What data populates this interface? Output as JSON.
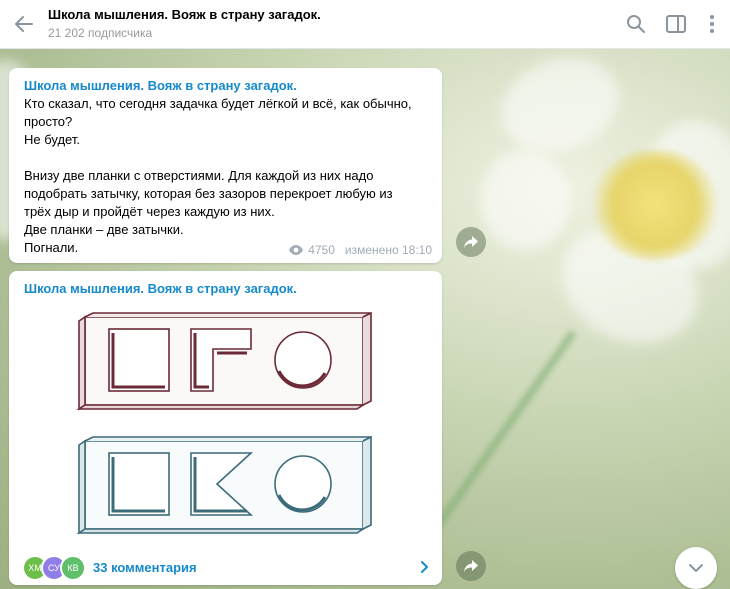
{
  "header": {
    "title": "Школа мышления. Вояж в страну загадок.",
    "subtitle": "21 202 подписчика"
  },
  "messages": [
    {
      "channel": "Школа мышления. Вояж в страну загадок.",
      "text": "Кто сказал, что сегодня задачка будет лёгкой и всё, как обычно,\nпросто?\nНе будет.\n\nВнизу две планки с отверстиями. Для каждой из них надо\nподобрать затычку, которая без зазоров перекроет любую из\nтрёх дыр и пройдёт через каждую из них.\nДве планки – две затычки.\nПогнали.",
      "views": "4750",
      "edited": "изменено 18:10"
    },
    {
      "channel": "Школа мышления. Вояж в страну загадок.",
      "comments": "33 комментария",
      "avatars": [
        {
          "initials": "ХМ",
          "color": "#6cc04a"
        },
        {
          "initials": "СУ",
          "color": "#8f7ee6"
        },
        {
          "initials": "КВ",
          "color": "#5fbf6a"
        }
      ]
    }
  ],
  "colors": {
    "accent": "#168acd",
    "plank_top": "#6b2a35",
    "plank_bottom": "#3c6b7a"
  },
  "icons": [
    "back-arrow-icon",
    "search-icon",
    "sidebar-toggle-icon",
    "more-vertical-icon",
    "eye-icon",
    "share-icon",
    "chevron-right-icon",
    "chevron-down-icon"
  ]
}
